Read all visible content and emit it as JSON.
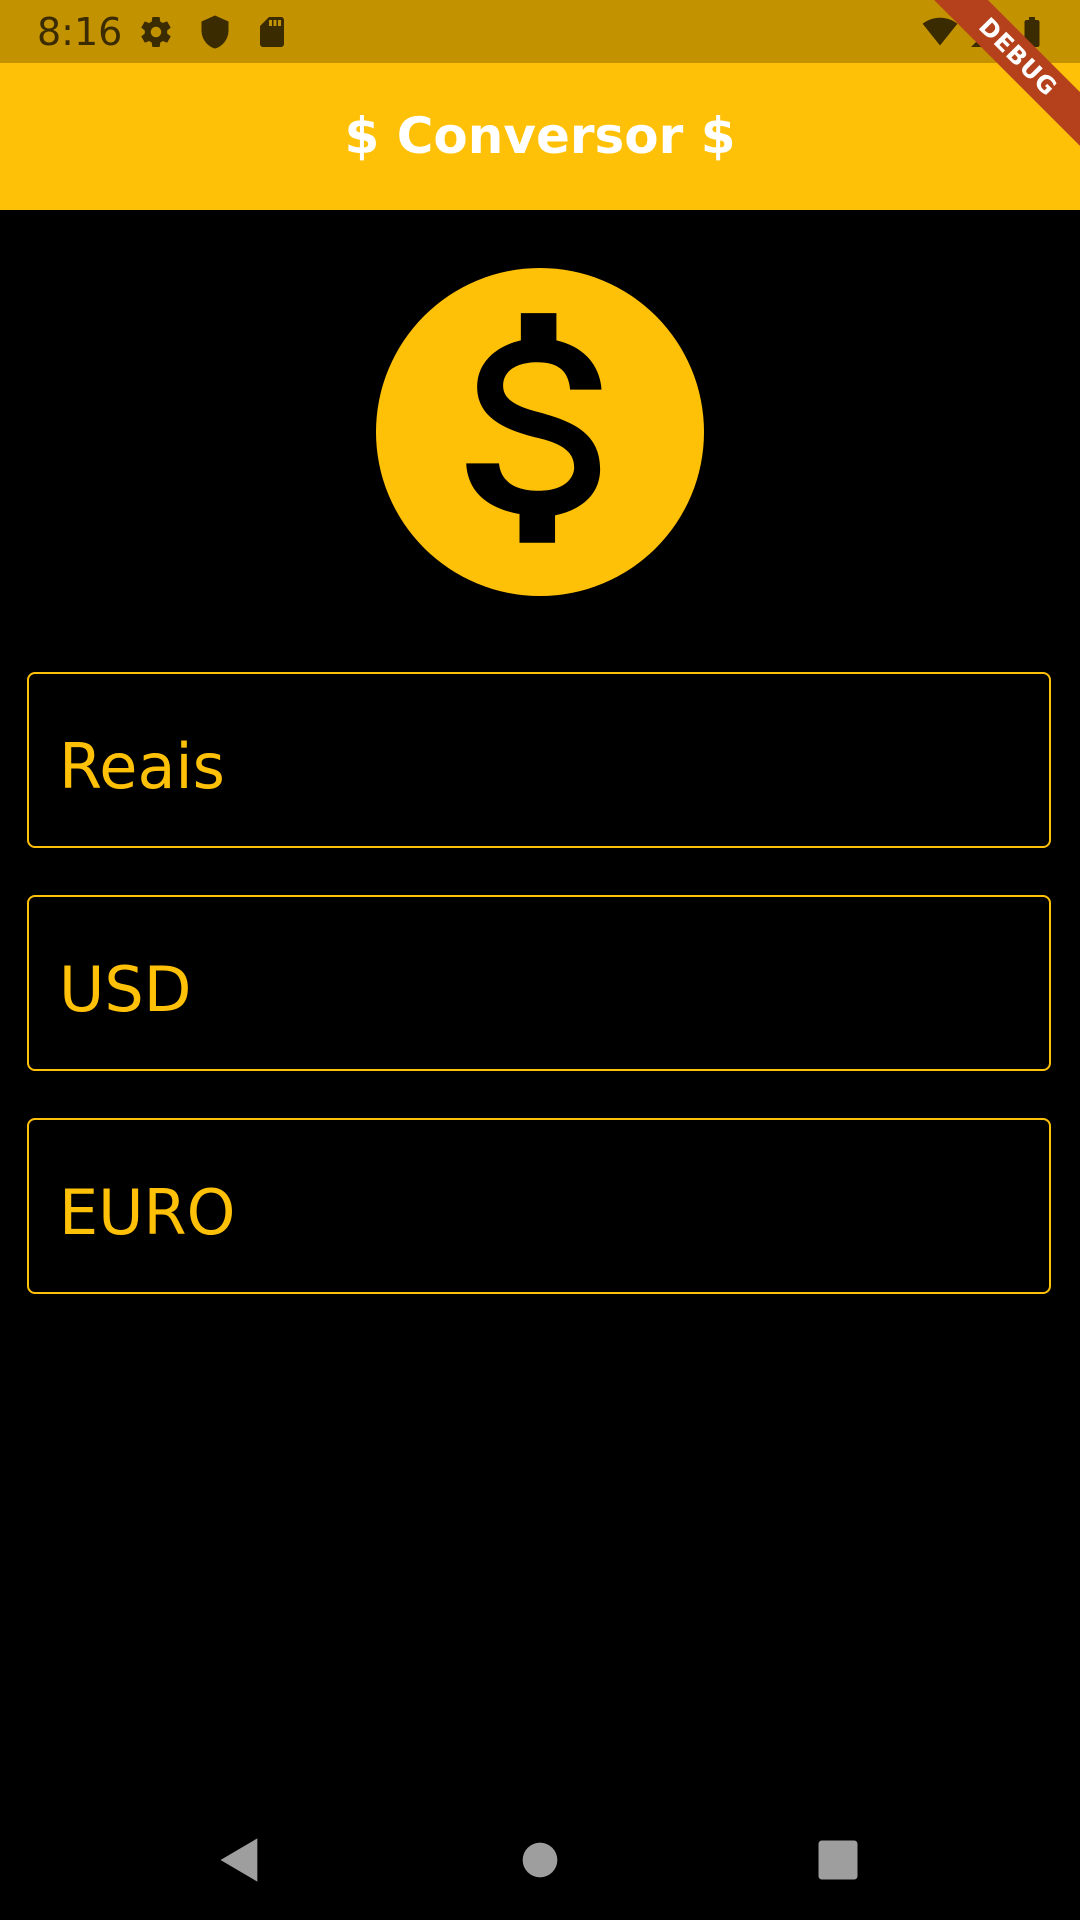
{
  "status_bar": {
    "time": "8:16",
    "icons": [
      "gear-icon",
      "shield-icon",
      "sd-card-icon",
      "wifi-icon",
      "signal-icon",
      "battery-icon"
    ]
  },
  "app_bar": {
    "title": "$ Conversor $"
  },
  "debug_banner": {
    "label": "DEBUG"
  },
  "main": {
    "icon": "monetization-icon",
    "fields": [
      {
        "label": "Reais"
      },
      {
        "label": "USD"
      },
      {
        "label": "EURO"
      }
    ]
  },
  "nav_bar": {
    "buttons": [
      "back-icon",
      "home-icon",
      "recents-icon"
    ]
  },
  "colors": {
    "accent": "#FFC107",
    "status_bar": "#C39200",
    "background": "#000000",
    "debug_ribbon": "#B4411C"
  }
}
